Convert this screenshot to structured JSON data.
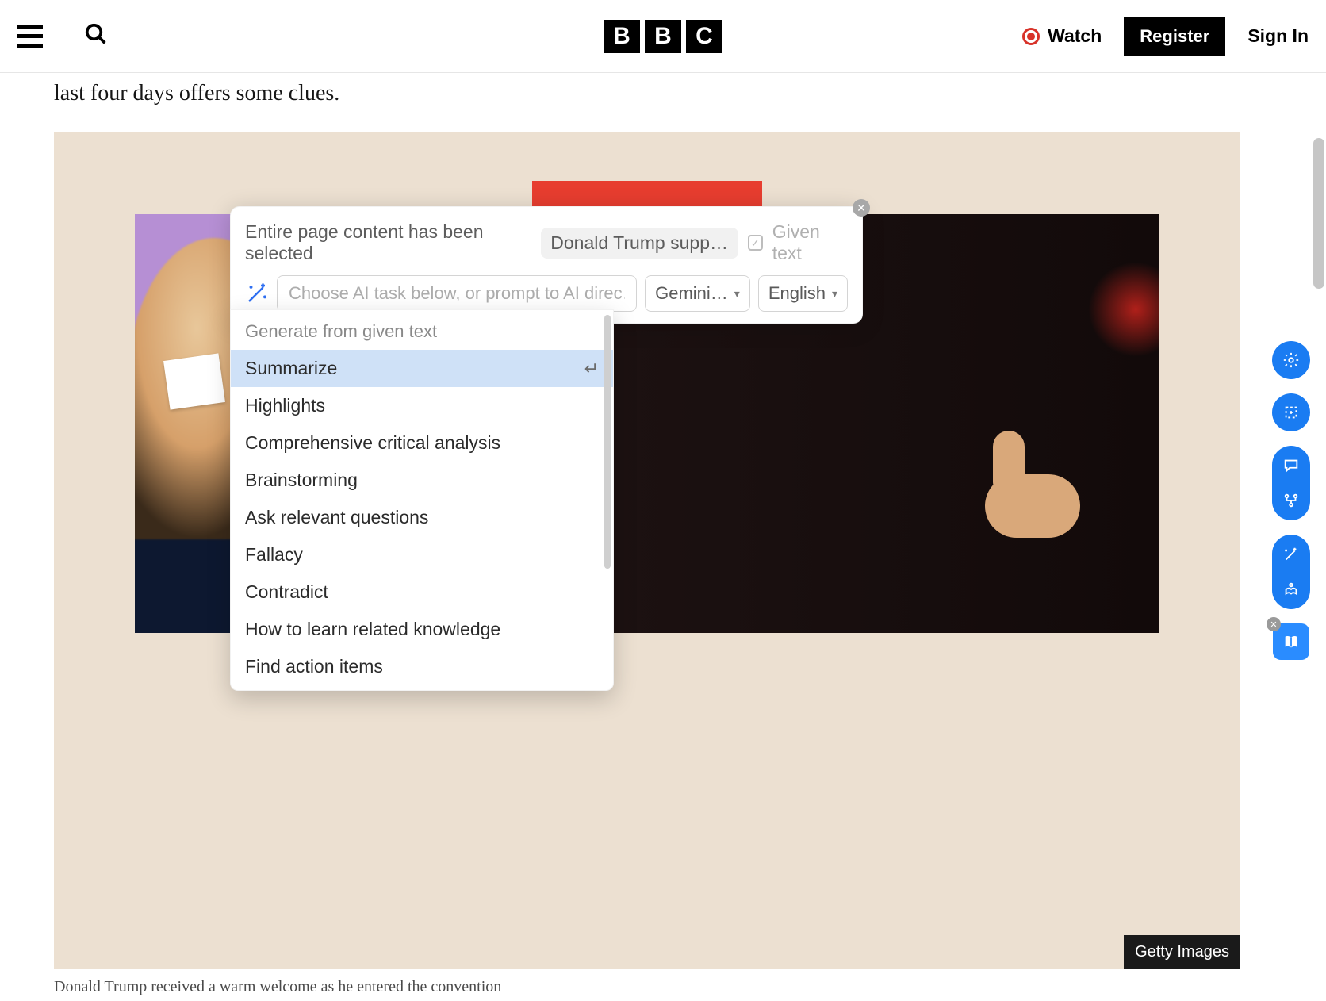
{
  "header": {
    "logo_letters": [
      "B",
      "B",
      "C"
    ],
    "watch_label": "Watch",
    "register_label": "Register",
    "signin_label": "Sign In"
  },
  "article": {
    "visible_text": "last four days offers some clues.",
    "credit": "Getty Images",
    "caption": "Donald Trump received a warm welcome as he entered the convention"
  },
  "ai_panel": {
    "context_line": "Entire page content has been selected",
    "chip_text": "Donald Trump suppor…",
    "given_text_label": "Given text",
    "prompt_placeholder": "Choose AI task below, or prompt to AI direc…",
    "model_selected": "Gemini…",
    "language_selected": "English"
  },
  "ai_dropdown": {
    "section_header": "Generate from given text",
    "active_item": "Summarize",
    "items": [
      "Summarize",
      "Highlights",
      "Comprehensive critical analysis",
      "Brainstorming",
      "Ask relevant questions",
      "Fallacy",
      "Contradict",
      "How to learn related knowledge",
      "Find action items"
    ]
  },
  "side_tools": {
    "settings": "gear-icon",
    "crop": "crop-icon",
    "chat": "chat-icon",
    "graph": "graph-icon",
    "wand": "wand-icon",
    "read": "read-icon",
    "book": "book-icon"
  }
}
